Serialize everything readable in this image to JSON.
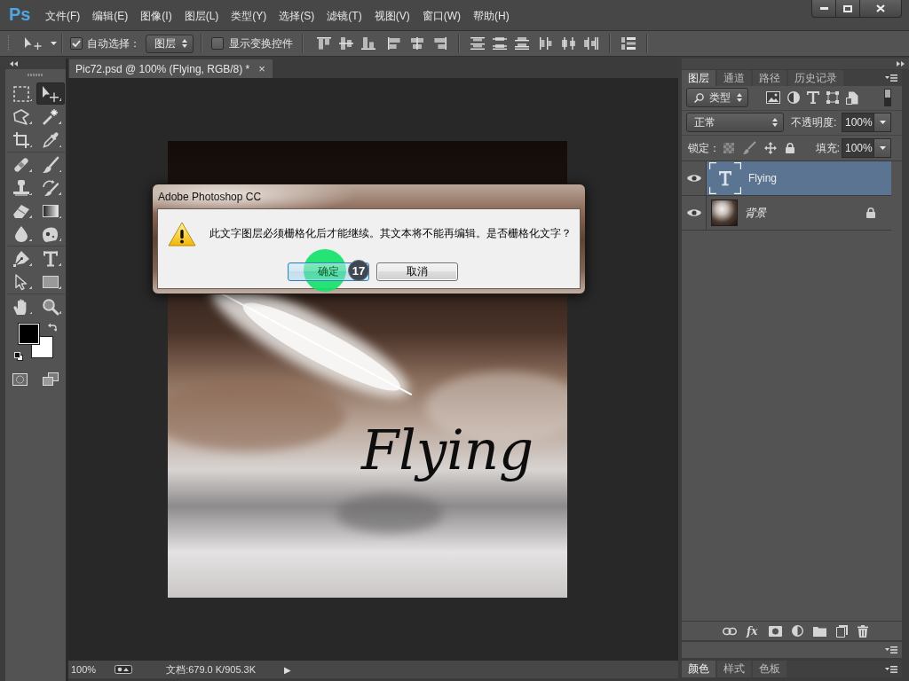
{
  "app": {
    "logo": "Ps"
  },
  "menu": [
    "文件(F)",
    "编辑(E)",
    "图像(I)",
    "图层(L)",
    "类型(Y)",
    "选择(S)",
    "滤镜(T)",
    "视图(V)",
    "窗口(W)",
    "帮助(H)"
  ],
  "options_bar": {
    "auto_select": {
      "label": "自动选择：",
      "checked": true
    },
    "auto_select_target": "图层",
    "transform_controls": {
      "label": "显示变换控件",
      "checked": false
    }
  },
  "toolbox": {
    "groups": [
      [
        {
          "kind": "marquee",
          "selected": false
        },
        {
          "kind": "move",
          "selected": true
        },
        {
          "kind": "lasso",
          "selected": false
        },
        {
          "kind": "wand",
          "selected": false
        },
        {
          "kind": "crop",
          "selected": false
        },
        {
          "kind": "eyedropper",
          "selected": false
        }
      ],
      [
        {
          "kind": "healing",
          "selected": false
        },
        {
          "kind": "brush",
          "selected": false
        },
        {
          "kind": "stamp",
          "selected": false
        },
        {
          "kind": "historybrush",
          "selected": false
        },
        {
          "kind": "eraser",
          "selected": false
        },
        {
          "kind": "gradient",
          "selected": false
        },
        {
          "kind": "blur",
          "selected": false
        },
        {
          "kind": "dodge",
          "selected": false
        }
      ],
      [
        {
          "kind": "pen",
          "selected": false
        },
        {
          "kind": "type",
          "selected": false
        },
        {
          "kind": "pathselect",
          "selected": false
        },
        {
          "kind": "shape",
          "selected": false
        }
      ],
      [
        {
          "kind": "hand",
          "selected": false
        },
        {
          "kind": "zoom",
          "selected": false
        }
      ]
    ]
  },
  "document": {
    "tab": {
      "title": "Pic72.psd @ 100% (Flying, RGB/8) *",
      "close": "×"
    },
    "canvas": {
      "text_layer": "Flying"
    },
    "status_bar": {
      "zoom": "100%",
      "info": "文档:679.0 K/905.3K",
      "arrow": "▶"
    }
  },
  "dialog": {
    "title": "Adobe Photoshop CC",
    "message": "此文字图层必须栅格化后才能继续。其文本将不能再编辑。是否栅格化文字？",
    "buttons": [
      {
        "label": "确定",
        "default": true
      },
      {
        "label": "取消",
        "default": false
      }
    ]
  },
  "tutorial_marker": {
    "step": "17"
  },
  "layers_panel": {
    "tabs": [
      {
        "label": "图层",
        "selected": true
      },
      {
        "label": "通道",
        "selected": false
      },
      {
        "label": "路径",
        "selected": false
      },
      {
        "label": "历史记录",
        "selected": false
      }
    ],
    "filter": "类型",
    "filter_on": true,
    "blend_mode": "正常",
    "opacity_label": "不透明度:",
    "opacity": "100%",
    "lock_label": "锁定：",
    "fill_label": "填充:",
    "fill": "100%",
    "layers": [
      {
        "name": "Flying",
        "kind": "text",
        "visible": true,
        "selected": true,
        "locked": false
      },
      {
        "name": "背景",
        "kind": "background",
        "visible": true,
        "selected": false,
        "locked": true
      }
    ],
    "effects_label": "fx"
  },
  "bottom_panel": {
    "tabs": [
      {
        "label": "颜色",
        "selected": true
      },
      {
        "label": "样式",
        "selected": false
      },
      {
        "label": "色板",
        "selected": false
      }
    ]
  }
}
